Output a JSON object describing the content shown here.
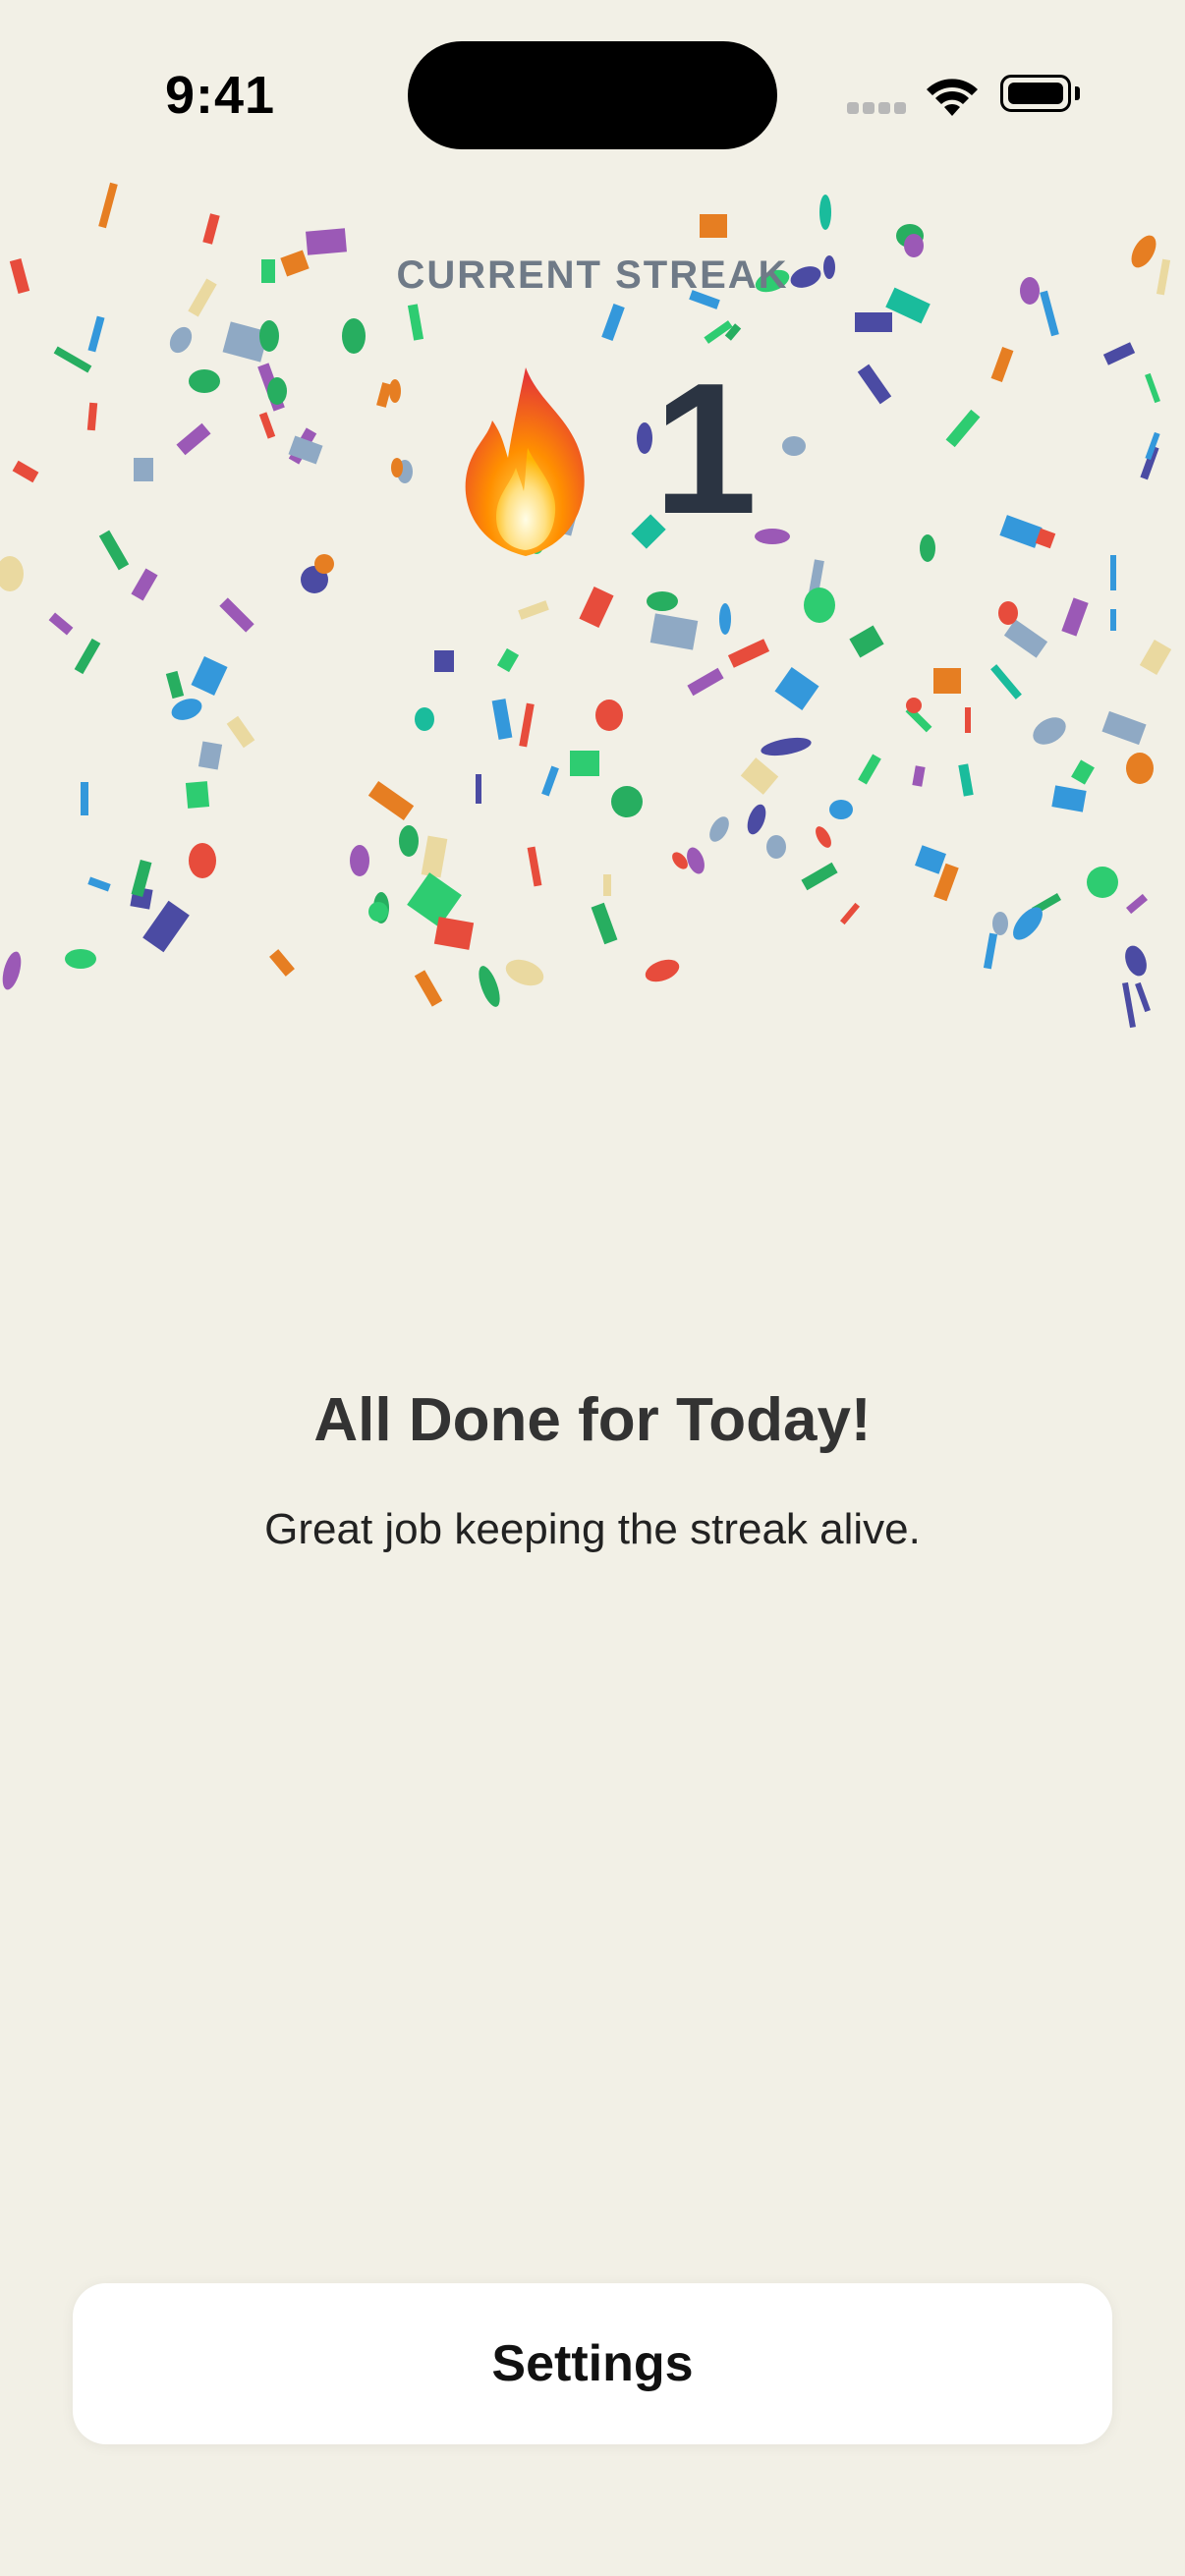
{
  "status_bar": {
    "time": "9:41"
  },
  "streak": {
    "label": "CURRENT STREAK",
    "count": "1",
    "icon": "flame-icon"
  },
  "message": {
    "title": "All Done for Today!",
    "subtitle": "Great job keeping the streak alive."
  },
  "actions": {
    "settings_label": "Settings"
  },
  "colors": {
    "background": "#f2f0e6",
    "streak_label": "#6f7a87",
    "streak_count": "#2b3442",
    "confetti_palette": [
      "#e74c3c",
      "#e67e22",
      "#2ecc71",
      "#27ae60",
      "#3498db",
      "#9b59b6",
      "#1abc9c",
      "#4b4ba3",
      "#8fa9c4",
      "#ead9a0"
    ]
  }
}
